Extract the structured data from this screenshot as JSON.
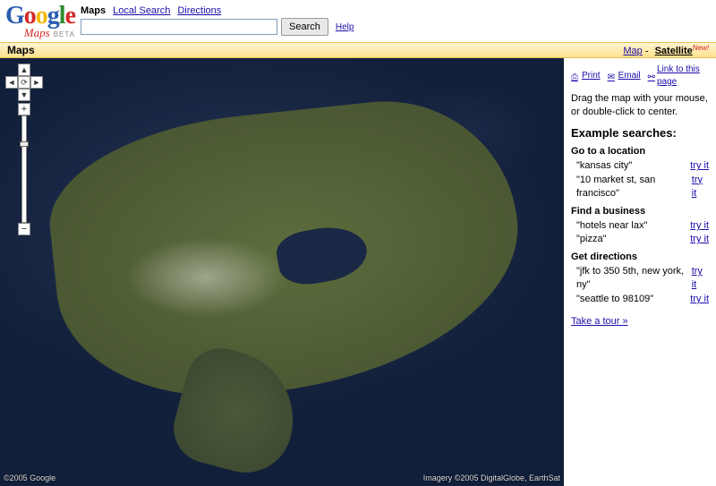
{
  "header": {
    "logo_segments": [
      "G",
      "o",
      "o",
      "g",
      "l",
      "e"
    ],
    "logo_sub": "Maps",
    "logo_beta": "BETA",
    "nav": {
      "maps": "Maps",
      "local": "Local Search",
      "directions": "Directions"
    },
    "search": {
      "value": "",
      "placeholder": "",
      "button": "Search"
    },
    "help": "Help"
  },
  "toolbar": {
    "title": "Maps",
    "view": {
      "map": "Map",
      "satellite": "Satellite",
      "new": "New!"
    }
  },
  "map": {
    "copyright_left": "©2005 Google",
    "copyright_right": "Imagery ©2005 DigitalGlobe, EarthSat"
  },
  "sidebar": {
    "actions": {
      "print": "Print",
      "email": "Email",
      "link": "Link to this page"
    },
    "tip": "Drag the map with your mouse, or double-click to center.",
    "heading": "Example searches:",
    "try_label": "try it",
    "groups": [
      {
        "title": "Go to a location",
        "items": [
          "\"kansas city\"",
          "\"10 market st, san francisco\""
        ]
      },
      {
        "title": "Find a business",
        "items": [
          "\"hotels near lax\"",
          "\"pizza\""
        ]
      },
      {
        "title": "Get directions",
        "items": [
          "\"jfk to 350 5th, new york, ny\"",
          "\"seattle to 98109\""
        ]
      }
    ],
    "tour": "Take a tour »"
  }
}
